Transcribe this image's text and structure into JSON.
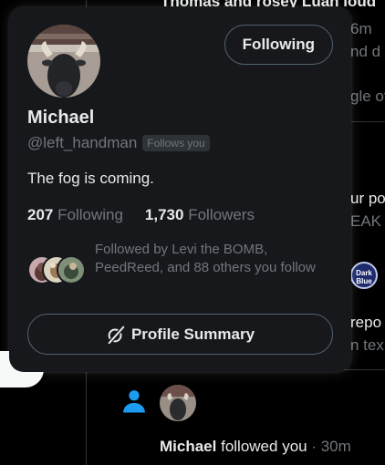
{
  "background": {
    "fragments": [
      "Thomas and rosey Luan loud",
      "6m",
      "nd d",
      "gle of",
      "ur po",
      "EAK",
      "repo",
      "n tex"
    ],
    "badge_text": "Dark Blue",
    "notification": {
      "name": "Michael",
      "action": "followed you",
      "time": "· 30m"
    }
  },
  "card": {
    "follow_button": "Following",
    "name": "Michael",
    "handle": "@left_handman",
    "follows_you": "Follows you",
    "bio": "The fog is coming.",
    "stats": {
      "following_count": "207",
      "following_label": "Following",
      "followers_count": "1,730",
      "followers_label": "Followers"
    },
    "followed_by": "Followed by Levi the BOMB, PeedReed, and 88 others you follow",
    "summary_button": "Profile Summary",
    "icons": {
      "summary": "grok-slash-icon",
      "avatar": "bull-statue-avatar"
    }
  },
  "colors": {
    "background": "#000000",
    "card": "#16181c",
    "text": "#e7e9ea",
    "muted": "#71767b",
    "border": "#536471",
    "accent": "#1d9bf0"
  }
}
